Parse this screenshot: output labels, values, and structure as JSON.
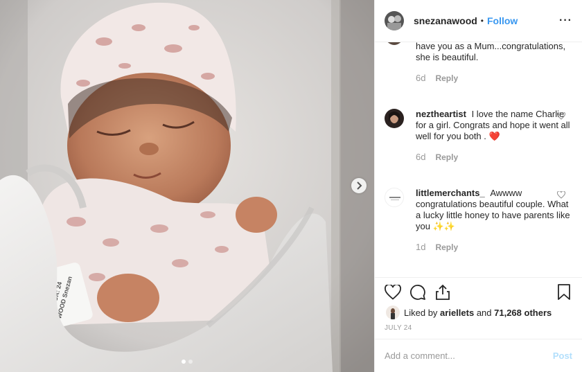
{
  "post": {
    "username": "snezanawood",
    "separator": "•",
    "follow_label": "Follow",
    "more_label": "···"
  },
  "comments": [
    {
      "username": "",
      "text": "have you as a Mum...congratulations, she is beautiful.",
      "age": "6d",
      "reply_label": "Reply"
    },
    {
      "username": "neztheartist",
      "text": "I love the name Charlie for a girl. Congrats and hope it went all well for you both . ❤️",
      "age": "6d",
      "reply_label": "Reply"
    },
    {
      "username": "littlemerchants_",
      "text": "Awwww congratulations beautiful couple. What a lucky little honey to have parents like you ✨✨",
      "age": "1d",
      "reply_label": "Reply"
    }
  ],
  "likes": {
    "prefix": "Liked by ",
    "user": "ariellets",
    "middle": " and ",
    "count": "71,268 others"
  },
  "date": "JULY 24",
  "add_comment": {
    "placeholder": "Add a comment...",
    "post_label": "Post"
  },
  "carousel": {
    "slide_count": 2,
    "active_index": 0
  },
  "colors": {
    "link_blue": "#3897f0",
    "post_disabled": "#b2dffc",
    "muted": "#999999",
    "heart_red": "#ed4956"
  },
  "icons": {
    "next": "chevron-right-icon",
    "like": "heart-icon",
    "comment": "speech-bubble-icon",
    "share": "share-icon",
    "save": "bookmark-icon",
    "options": "more-options-icon"
  }
}
